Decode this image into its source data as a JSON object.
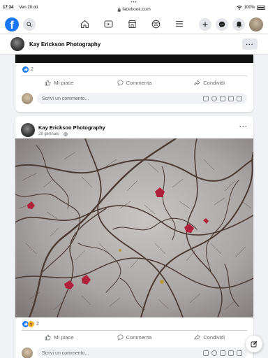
{
  "status_bar": {
    "time": "17:34",
    "date": "Ven 20 ott",
    "url": "facebook.com",
    "battery": "100%"
  },
  "nav": {
    "logo": "f",
    "icons": [
      "search-icon",
      "home-icon",
      "video-icon",
      "marketplace-icon",
      "groups-icon",
      "menu-icon",
      "plus-icon",
      "messenger-icon",
      "notifications-icon"
    ]
  },
  "page_header": {
    "name": "Kay Erickson Photography",
    "more": "···"
  },
  "post1": {
    "reaction_count": "2",
    "actions": {
      "like": "Mi piace",
      "comment": "Commenta",
      "share": "Condividi"
    },
    "comment_placeholder": "Scrivi un commento..."
  },
  "post2": {
    "author": "Kay Erickson Photography",
    "date": "28 gennaio",
    "more": "···",
    "reaction_count": "2",
    "actions": {
      "like": "Mi piace",
      "comment": "Commenta",
      "share": "Condividi"
    },
    "comment_placeholder": "Scrivi un commento..."
  },
  "colors": {
    "facebook_blue": "#1877f2",
    "background": "#f0f2f5",
    "text_secondary": "#65676b"
  }
}
